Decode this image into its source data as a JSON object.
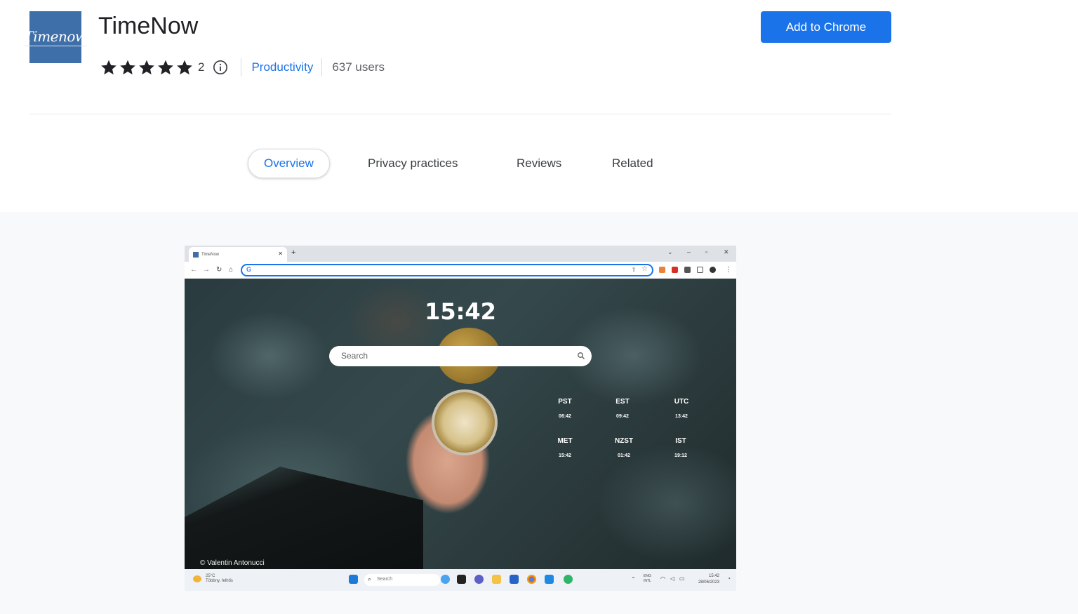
{
  "extension": {
    "name": "TimeNow",
    "logo_text": "Timenow",
    "rating_count": "2",
    "category": "Productivity",
    "users": "637 users",
    "add_button": "Add to Chrome"
  },
  "rating": {
    "stars": 5,
    "max": 5
  },
  "tabs": [
    {
      "label": "Overview",
      "active": true
    },
    {
      "label": "Privacy practices",
      "active": false
    },
    {
      "label": "Reviews",
      "active": false
    },
    {
      "label": "Related",
      "active": false
    }
  ],
  "screenshot": {
    "tab_title": "TimeNow",
    "clock": "15:42",
    "search_placeholder": "Search",
    "timezones": [
      {
        "name": "PST",
        "time": "06:42"
      },
      {
        "name": "EST",
        "time": "09:42"
      },
      {
        "name": "UTC",
        "time": "13:42"
      },
      {
        "name": "MET",
        "time": "15:42"
      },
      {
        "name": "NZST",
        "time": "01:42"
      },
      {
        "name": "IST",
        "time": "19:12"
      }
    ],
    "credit": "© Valentin Antonucci",
    "taskbar": {
      "weather_temp": "25°C",
      "weather_desc": "Többny. felhős",
      "search": "Search",
      "lang1": "ENG",
      "lang2": "INTL",
      "time": "15:42",
      "date": "28/06/2023"
    }
  },
  "colors": {
    "accent": "#1a73e8",
    "logo_bg": "#3e6fa8"
  }
}
